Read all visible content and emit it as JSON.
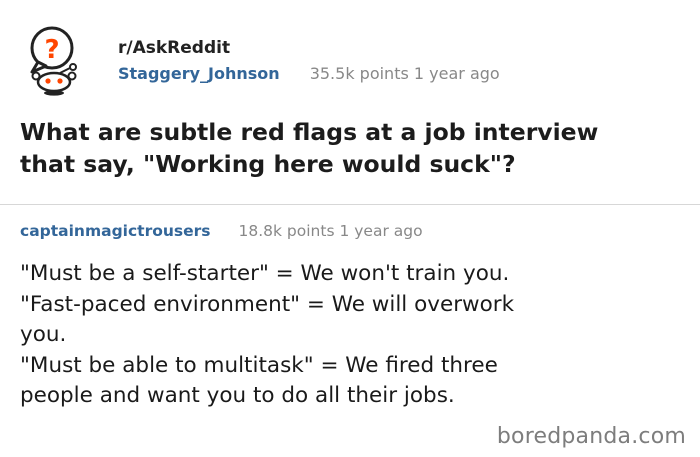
{
  "post": {
    "subreddit": "r/AskReddit",
    "username": "Staggery_Johnson",
    "points": "35.5k points 1 year ago",
    "title_lines": [
      "What are subtle red flags at a job interview",
      "that say, \"Working here would suck\"?"
    ]
  },
  "comment": {
    "username": "captainmagictrousers",
    "points": "18.8k points 1 year ago",
    "lines": [
      "\"Must be a self-starter\" = We won't train you.",
      "\"Fast-paced environment\" = We will overwork",
      "you.",
      "\"Must be able to multitask\" = We fired three",
      "people and want you to do all their jobs."
    ]
  },
  "watermark": "boredpanda.com",
  "colors": {
    "username": "#336699",
    "meta_gray": "#888888",
    "mascot_red": "#ff4500"
  },
  "icons": {
    "avatar": "reddit-askreddit-mascot-icon"
  }
}
